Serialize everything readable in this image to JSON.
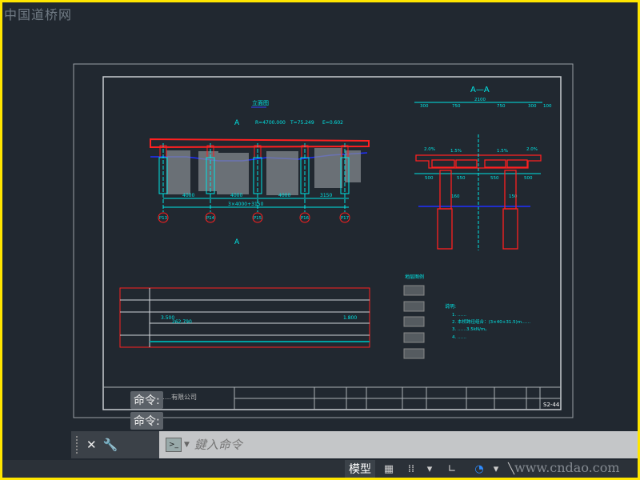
{
  "watermark": "中国道桥网",
  "drawing": {
    "elevation_title": "立面图",
    "section_mark": "A",
    "curve": {
      "R": "R=4700.000",
      "T": "T=75.249",
      "E": "E=0.602"
    },
    "spans": [
      "4000",
      "4000",
      "4000",
      "3150"
    ],
    "span_total": "3×4000+3150",
    "piers": [
      "P13",
      "P14",
      "P15",
      "P16",
      "P17"
    ],
    "section_title": "A—A",
    "section_dims": {
      "total": "2100",
      "top": [
        "300",
        "750",
        "750",
        "300"
      ],
      "right": "100",
      "bottom": [
        "500",
        "550",
        "550",
        "500"
      ],
      "pier": "160",
      "pile": "150"
    },
    "slopes": [
      "2.0%",
      "1.5%",
      "1.5%",
      "2.0%"
    ],
    "profile_values": {
      "grade_left": "3.500",
      "grade_right": "1.800",
      "elev": "262.790"
    },
    "legend_title": "地层图例",
    "notes_label": "说明:",
    "notes": [
      "1. ……",
      "2. 本桥跨径组合：(3×40+31.5)m……",
      "3. ……3.5kN/m。",
      "4. ……"
    ]
  },
  "titleblock": {
    "company": "……有限公司",
    "sheet": "S2-44"
  },
  "command": {
    "history": [
      "命令:",
      "命令:"
    ],
    "placeholder": "鍵入命令",
    "close": "✕",
    "customize": "🔧",
    "prompt": ">_"
  },
  "status": {
    "model_tab": "模型",
    "site": "www.cndao.com"
  }
}
